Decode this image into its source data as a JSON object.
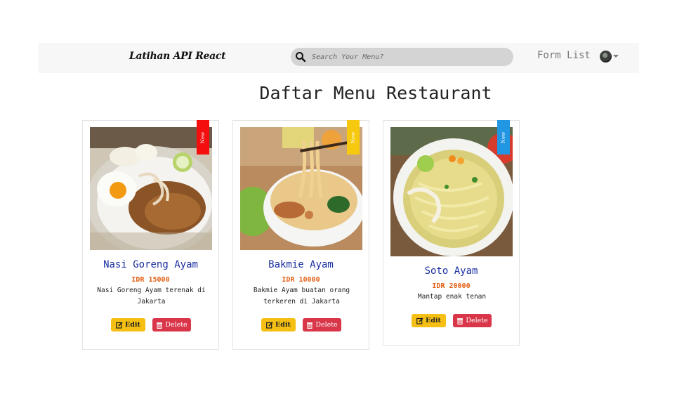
{
  "navbar": {
    "brand": "Latihan API React",
    "search_placeholder": "Search Your Menu?",
    "form_list_label": "Form List"
  },
  "page_title": "Daftar Menu Restaurant",
  "menus": [
    {
      "badge": "New",
      "badge_color": "#f40e0e",
      "name": "Nasi Goreng Ayam",
      "price": "IDR 15000",
      "desc": "Nasi Goreng Ayam terenak di Jakarta",
      "edit_label": "Edit",
      "delete_label": "Delete"
    },
    {
      "badge": "New",
      "badge_color": "#f6c90f",
      "name": "Bakmie Ayam",
      "price": "IDR 10000",
      "desc": "Bakmie Ayam buatan orang terkeren di Jakarta",
      "edit_label": "Edit",
      "delete_label": "Delete"
    },
    {
      "badge": "New",
      "badge_color": "#2196e3",
      "name": "Soto Ayam",
      "price": "IDR 20000",
      "desc": "Mantap enak tenan",
      "edit_label": "Edit",
      "delete_label": "Delete"
    }
  ]
}
